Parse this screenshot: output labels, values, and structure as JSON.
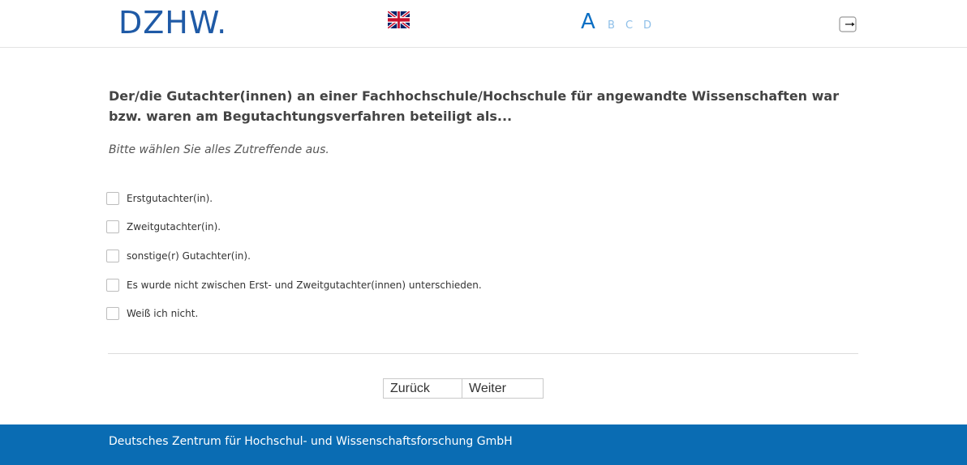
{
  "header": {
    "logo_text": "DZHW.",
    "language_flag": "uk-flag-icon",
    "font_sizes": [
      "A",
      "B",
      "C",
      "D"
    ],
    "logout_icon": "logout-icon"
  },
  "question": {
    "text": "Der/die Gutachter(innen) an einer Fachhochschule/Hochschule für angewandte Wissenschaften war bzw. waren am Begutachtungsverfahren beteiligt als...",
    "hint": "Bitte wählen Sie alles Zutreffende aus."
  },
  "options": [
    {
      "label": "Erstgutachter(in).",
      "checked": false
    },
    {
      "label": "Zweitgutachter(in).",
      "checked": false
    },
    {
      "label": "sonstige(r) Gutachter(in).",
      "checked": false
    },
    {
      "label": "Es wurde nicht zwischen Erst- und Zweitgutachter(innen) unterschieden.",
      "checked": false
    },
    {
      "label": "Weiß ich nicht.",
      "checked": false
    }
  ],
  "nav": {
    "back_label": "Zurück",
    "next_label": "Weiter"
  },
  "footer": {
    "text": "Deutsches Zentrum für Hochschul- und Wissenschaftsforschung GmbH"
  },
  "colors": {
    "accent": "#0b6fc4",
    "logo": "#1f5aa6",
    "footer_bg": "#0a6cb3"
  }
}
